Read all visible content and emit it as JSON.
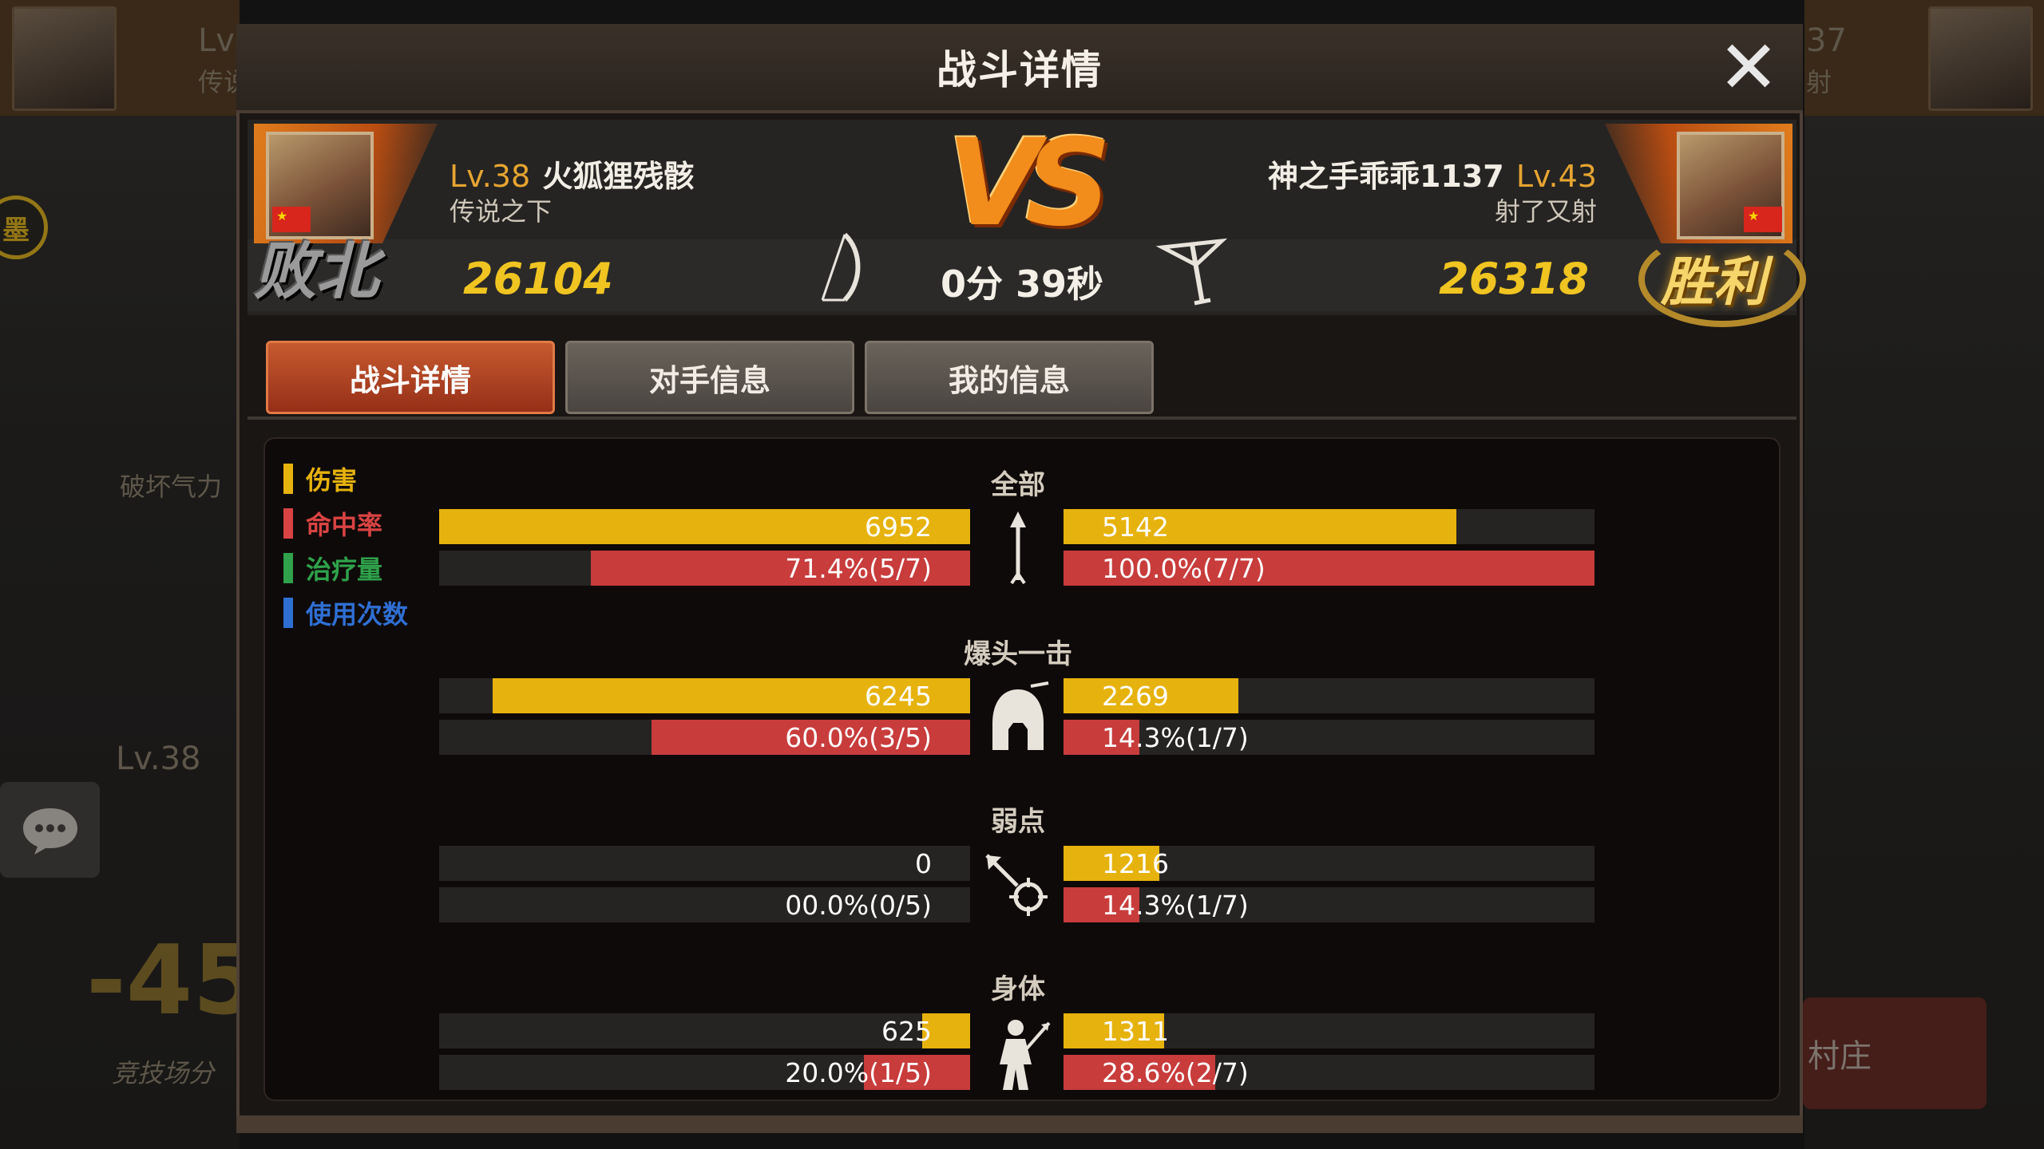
{
  "background": {
    "left_level": "Lv",
    "left_subtitle": "传说",
    "right_level": "37",
    "right_subtitle": "射",
    "left_badge": "墨",
    "side_label": "破坏气力",
    "side_level": "Lv.38",
    "side_score_fragment": "-45",
    "side_arena_label": "竞技场分",
    "village_label": "村庄"
  },
  "dialog": {
    "title": "战斗详情",
    "close_label": "✕"
  },
  "left_player": {
    "level": "Lv.38",
    "name": "火狐狸残骸",
    "title": "传说之下",
    "score": "26104",
    "result": "败北"
  },
  "right_player": {
    "level": "Lv.43",
    "name": "神之手乖乖1137",
    "title": "射了又射",
    "score": "26318",
    "result": "胜利"
  },
  "battle": {
    "vs": "VS",
    "duration": "0分 39秒"
  },
  "tabs": [
    {
      "label": "战斗详情",
      "active": true
    },
    {
      "label": "对手信息",
      "active": false
    },
    {
      "label": "我的信息",
      "active": false
    }
  ],
  "legend": [
    {
      "label": "伤害",
      "color": "#e6b20d"
    },
    {
      "label": "命中率",
      "color": "#d94343"
    },
    {
      "label": "治疗量",
      "color": "#2fa24b"
    },
    {
      "label": "使用次数",
      "color": "#2f6fd3"
    }
  ],
  "sections": [
    {
      "title": "全部",
      "icon": "arrow-icon",
      "left": {
        "damage": "6952",
        "damage_ratio": 1.0,
        "hit": "71.4%(5/7)",
        "hit_ratio": 0.714
      },
      "right": {
        "damage": "5142",
        "damage_ratio": 0.74,
        "hit": "100.0%(7/7)",
        "hit_ratio": 1.0
      }
    },
    {
      "title": "爆头一击",
      "icon": "helmet-icon",
      "left": {
        "damage": "6245",
        "damage_ratio": 0.9,
        "hit": "60.0%(3/5)",
        "hit_ratio": 0.6
      },
      "right": {
        "damage": "2269",
        "damage_ratio": 0.33,
        "hit": "14.3%(1/7)",
        "hit_ratio": 0.143
      }
    },
    {
      "title": "弱点",
      "icon": "crosshair-arrow-icon",
      "left": {
        "damage": "0",
        "damage_ratio": 0,
        "hit": "00.0%(0/5)",
        "hit_ratio": 0
      },
      "right": {
        "damage": "1216",
        "damage_ratio": 0.18,
        "hit": "14.3%(1/7)",
        "hit_ratio": 0.143
      }
    },
    {
      "title": "身体",
      "icon": "body-icon",
      "left": {
        "damage": "625",
        "damage_ratio": 0.09,
        "hit": "20.0%(1/5)",
        "hit_ratio": 0.2
      },
      "right": {
        "damage": "1311",
        "damage_ratio": 0.19,
        "hit": "28.6%(2/7)",
        "hit_ratio": 0.286
      }
    }
  ]
}
